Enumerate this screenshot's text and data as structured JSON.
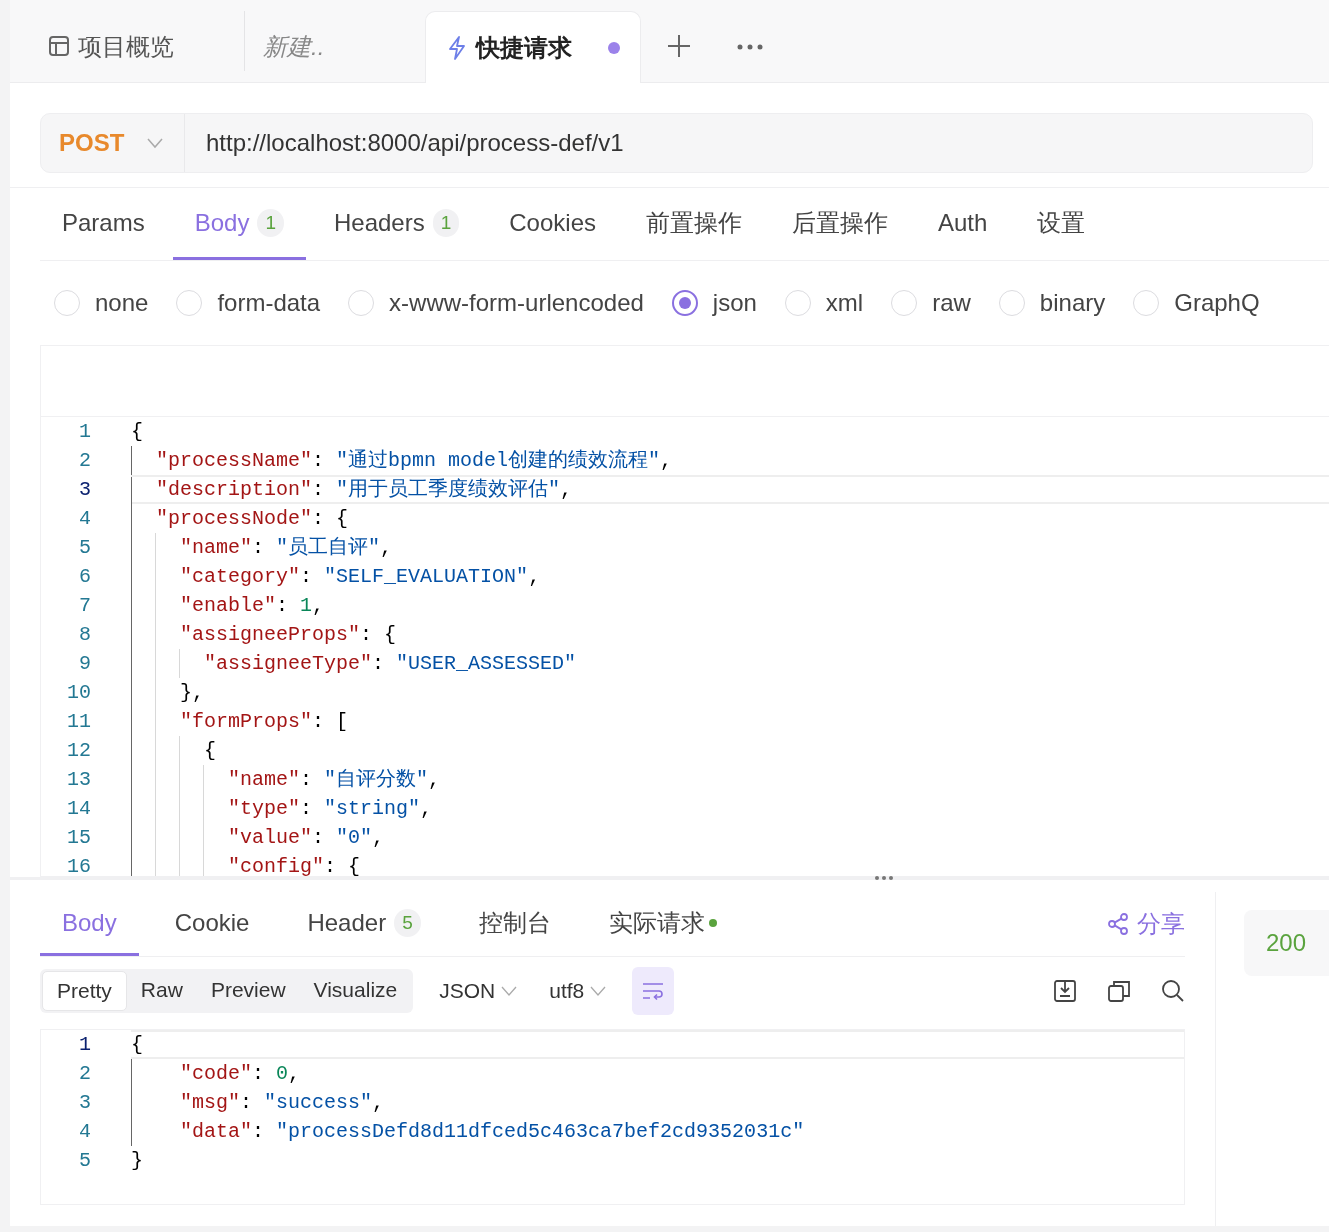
{
  "tabs": [
    {
      "kind": "overview",
      "label": "项目概览",
      "selected": false,
      "unsaved": false
    },
    {
      "kind": "draft",
      "label": "新建..",
      "selected": false,
      "unsaved": false
    },
    {
      "kind": "request",
      "label": "快捷请求",
      "selected": true,
      "unsaved": true
    }
  ],
  "request": {
    "method": "POST",
    "url": "http://localhost:8000/api/process-def/v1"
  },
  "request_tabs": [
    {
      "label": "Params",
      "selected": false
    },
    {
      "label": "Body",
      "badge": "1",
      "selected": true
    },
    {
      "label": "Headers",
      "badge": "1",
      "selected": false
    },
    {
      "label": "Cookies",
      "selected": false
    },
    {
      "label": "前置操作",
      "selected": false
    },
    {
      "label": "后置操作",
      "selected": false
    },
    {
      "label": "Auth",
      "selected": false
    },
    {
      "label": "设置",
      "selected": false
    }
  ],
  "body_types": [
    {
      "label": "none",
      "selected": false
    },
    {
      "label": "form-data",
      "selected": false
    },
    {
      "label": "x-www-form-urlencoded",
      "selected": false
    },
    {
      "label": "json",
      "selected": true
    },
    {
      "label": "xml",
      "selected": false
    },
    {
      "label": "raw",
      "selected": false
    },
    {
      "label": "binary",
      "selected": false
    },
    {
      "label": "GraphQ",
      "selected": false
    }
  ],
  "editor": {
    "lines": [
      {
        "number": "1",
        "current": false,
        "tokens": [
          {
            "kind": "punct",
            "text": "{"
          }
        ]
      },
      {
        "number": "2",
        "current": false,
        "tokens": [
          {
            "kind": "key",
            "text": "  \"processName\""
          },
          {
            "kind": "punct",
            "text": ": "
          },
          {
            "kind": "string",
            "text": "\"通过bpmn model创建的绩效流程\""
          },
          {
            "kind": "punct",
            "text": ","
          }
        ]
      },
      {
        "number": "3",
        "current": true,
        "tokens": [
          {
            "kind": "key",
            "text": "  \"description\""
          },
          {
            "kind": "punct",
            "text": ": "
          },
          {
            "kind": "string",
            "text": "\"用于员工季度绩效评估\""
          },
          {
            "kind": "punct",
            "text": ","
          }
        ]
      },
      {
        "number": "4",
        "current": false,
        "tokens": [
          {
            "kind": "key",
            "text": "  \"processNode\""
          },
          {
            "kind": "punct",
            "text": ": {"
          }
        ]
      },
      {
        "number": "5",
        "current": false,
        "tokens": [
          {
            "kind": "key",
            "text": "    \"name\""
          },
          {
            "kind": "punct",
            "text": ": "
          },
          {
            "kind": "string",
            "text": "\"员工自评\""
          },
          {
            "kind": "punct",
            "text": ","
          }
        ]
      },
      {
        "number": "6",
        "current": false,
        "tokens": [
          {
            "kind": "key",
            "text": "    \"category\""
          },
          {
            "kind": "punct",
            "text": ": "
          },
          {
            "kind": "string",
            "text": "\"SELF_EVALUATION\""
          },
          {
            "kind": "punct",
            "text": ","
          }
        ]
      },
      {
        "number": "7",
        "current": false,
        "tokens": [
          {
            "kind": "key",
            "text": "    \"enable\""
          },
          {
            "kind": "punct",
            "text": ": "
          },
          {
            "kind": "number",
            "text": "1"
          },
          {
            "kind": "punct",
            "text": ","
          }
        ]
      },
      {
        "number": "8",
        "current": false,
        "tokens": [
          {
            "kind": "key",
            "text": "    \"assigneeProps\""
          },
          {
            "kind": "punct",
            "text": ": {"
          }
        ]
      },
      {
        "number": "9",
        "current": false,
        "tokens": [
          {
            "kind": "key",
            "text": "      \"assigneeType\""
          },
          {
            "kind": "punct",
            "text": ": "
          },
          {
            "kind": "string",
            "text": "\"USER_ASSESSED\""
          }
        ]
      },
      {
        "number": "10",
        "current": false,
        "tokens": [
          {
            "kind": "punct",
            "text": "    },"
          }
        ]
      },
      {
        "number": "11",
        "current": false,
        "tokens": [
          {
            "kind": "key",
            "text": "    \"formProps\""
          },
          {
            "kind": "punct",
            "text": ": ["
          }
        ]
      },
      {
        "number": "12",
        "current": false,
        "tokens": [
          {
            "kind": "punct",
            "text": "      {"
          }
        ]
      },
      {
        "number": "13",
        "current": false,
        "tokens": [
          {
            "kind": "key",
            "text": "        \"name\""
          },
          {
            "kind": "punct",
            "text": ": "
          },
          {
            "kind": "string",
            "text": "\"自评分数\""
          },
          {
            "kind": "punct",
            "text": ","
          }
        ]
      },
      {
        "number": "14",
        "current": false,
        "tokens": [
          {
            "kind": "key",
            "text": "        \"type\""
          },
          {
            "kind": "punct",
            "text": ": "
          },
          {
            "kind": "string",
            "text": "\"string\""
          },
          {
            "kind": "punct",
            "text": ","
          }
        ]
      },
      {
        "number": "15",
        "current": false,
        "tokens": [
          {
            "kind": "key",
            "text": "        \"value\""
          },
          {
            "kind": "punct",
            "text": ": "
          },
          {
            "kind": "string",
            "text": "\"0\""
          },
          {
            "kind": "punct",
            "text": ","
          }
        ]
      },
      {
        "number": "16",
        "current": false,
        "tokens": [
          {
            "kind": "key",
            "text": "        \"config\""
          },
          {
            "kind": "punct",
            "text": ": {"
          }
        ]
      }
    ]
  },
  "response": {
    "tabs": [
      {
        "label": "Body",
        "selected": true,
        "indicator": false
      },
      {
        "label": "Cookie",
        "selected": false,
        "indicator": false
      },
      {
        "label": "Header",
        "badge": "5",
        "selected": false,
        "indicator": false
      },
      {
        "label": "控制台",
        "selected": false,
        "indicator": false
      },
      {
        "label": "实际请求",
        "selected": false,
        "indicator": true
      }
    ],
    "share": "分享",
    "views": [
      {
        "label": "Pretty",
        "selected": true
      },
      {
        "label": "Raw",
        "selected": false
      },
      {
        "label": "Preview",
        "selected": false
      },
      {
        "label": "Visualize",
        "selected": false
      }
    ],
    "format": "JSON",
    "encoding": "utf8",
    "wrap_on": true,
    "lines": [
      {
        "number": "1",
        "current": true,
        "tokens": [
          {
            "kind": "punct",
            "text": "{"
          }
        ]
      },
      {
        "number": "2",
        "current": false,
        "tokens": [
          {
            "kind": "key",
            "text": "    \"code\""
          },
          {
            "kind": "punct",
            "text": ": "
          },
          {
            "kind": "number",
            "text": "0"
          },
          {
            "kind": "punct",
            "text": ","
          }
        ]
      },
      {
        "number": "3",
        "current": false,
        "tokens": [
          {
            "kind": "key",
            "text": "    \"msg\""
          },
          {
            "kind": "punct",
            "text": ": "
          },
          {
            "kind": "string",
            "text": "\"success\""
          },
          {
            "kind": "punct",
            "text": ","
          }
        ]
      },
      {
        "number": "4",
        "current": false,
        "tokens": [
          {
            "kind": "key",
            "text": "    \"data\""
          },
          {
            "kind": "punct",
            "text": ": "
          },
          {
            "kind": "string",
            "text": "\"processDefd8d11dfced5c463ca7bef2cd9352031c\""
          }
        ]
      },
      {
        "number": "5",
        "current": false,
        "tokens": [
          {
            "kind": "punct",
            "text": "}"
          }
        ]
      }
    ]
  },
  "status": {
    "code": "200"
  }
}
